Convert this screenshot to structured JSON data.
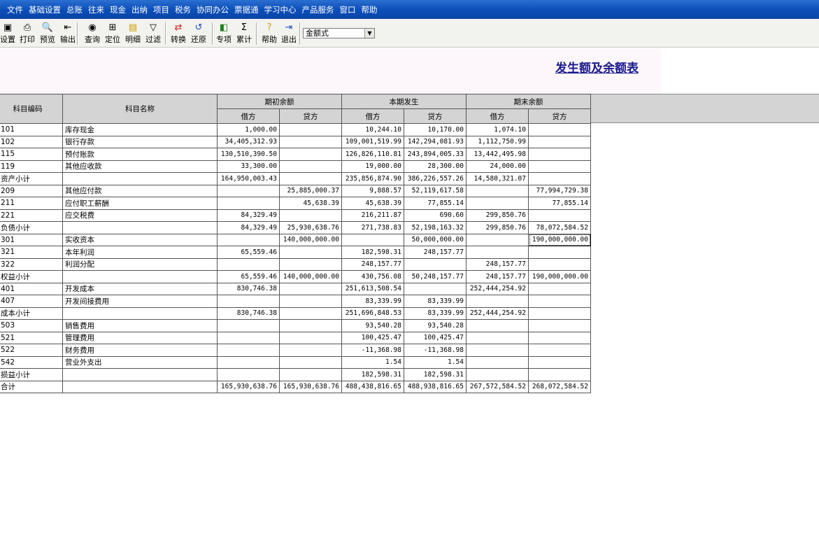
{
  "menu": [
    "文件",
    "基础设置",
    "总账",
    "往来",
    "现金",
    "出纳",
    "项目",
    "税务",
    "协同办公",
    "票据通",
    "学习中心",
    "产品服务",
    "窗口",
    "帮助"
  ],
  "toolbar": {
    "buttons": [
      {
        "label": "设置",
        "icon": "settings-icon"
      },
      {
        "label": "打印",
        "icon": "print-icon"
      },
      {
        "label": "预览",
        "icon": "preview-icon"
      },
      {
        "label": "输出",
        "icon": "export-icon"
      },
      {
        "label": "查询",
        "icon": "binoculars-icon"
      },
      {
        "label": "定位",
        "icon": "locate-icon"
      },
      {
        "label": "明细",
        "icon": "detail-icon"
      },
      {
        "label": "过滤",
        "icon": "filter-icon"
      },
      {
        "label": "转换",
        "icon": "convert-icon"
      },
      {
        "label": "还原",
        "icon": "restore-icon"
      },
      {
        "label": "专项",
        "icon": "special-icon"
      },
      {
        "label": "累计",
        "icon": "sigma-icon"
      },
      {
        "label": "帮助",
        "icon": "help-icon"
      },
      {
        "label": "退出",
        "icon": "exit-icon"
      }
    ],
    "format_select": "金额式"
  },
  "report_title": "发生额及余额表",
  "table": {
    "headers": {
      "code": "科目编码",
      "name": "科目名称",
      "opening": "期初余额",
      "period": "本期发生",
      "closing": "期末余额",
      "debit": "借方",
      "credit": "贷方"
    },
    "rows": [
      {
        "code": "101",
        "name": "库存现金",
        "od": "1,000.00",
        "oc": "",
        "pd": "10,244.10",
        "pc": "10,170.00",
        "cd": "1,074.10",
        "cc": ""
      },
      {
        "code": "102",
        "name": "银行存款",
        "od": "34,405,312.93",
        "oc": "",
        "pd": "109,001,519.99",
        "pc": "142,294,081.93",
        "cd": "1,112,750.99",
        "cc": ""
      },
      {
        "code": "115",
        "name": "预付账款",
        "od": "130,510,390.50",
        "oc": "",
        "pd": "126,826,110.81",
        "pc": "243,894,005.33",
        "cd": "13,442,495.98",
        "cc": ""
      },
      {
        "code": "119",
        "name": "其他应收款",
        "od": "33,300.00",
        "oc": "",
        "pd": "19,000.00",
        "pc": "28,300.00",
        "cd": "24,000.00",
        "cc": ""
      },
      {
        "code": "资产小计",
        "name": "",
        "od": "164,950,003.43",
        "oc": "",
        "pd": "235,856,874.90",
        "pc": "386,226,557.26",
        "cd": "14,580,321.07",
        "cc": ""
      },
      {
        "code": "209",
        "name": "其他应付款",
        "od": "",
        "oc": "25,885,000.37",
        "pd": "9,888.57",
        "pc": "52,119,617.58",
        "cd": "",
        "cc": "77,994,729.38"
      },
      {
        "code": "211",
        "name": "应付职工薪酬",
        "od": "",
        "oc": "45,638.39",
        "pd": "45,638.39",
        "pc": "77,855.14",
        "cd": "",
        "cc": "77,855.14"
      },
      {
        "code": "221",
        "name": "应交税费",
        "od": "84,329.49",
        "oc": "",
        "pd": "216,211.87",
        "pc": "690.60",
        "cd": "299,850.76",
        "cc": ""
      },
      {
        "code": "负债小计",
        "name": "",
        "od": "84,329.49",
        "oc": "25,930,638.76",
        "pd": "271,738.83",
        "pc": "52,198,163.32",
        "cd": "299,850.76",
        "cc": "78,072,584.52"
      },
      {
        "code": "301",
        "name": "实收资本",
        "od": "",
        "oc": "140,000,000.00",
        "pd": "",
        "pc": "50,000,000.00",
        "cd": "",
        "cc": "190,000,000.00"
      },
      {
        "code": "321",
        "name": "本年利润",
        "od": "65,559.46",
        "oc": "",
        "pd": "182,598.31",
        "pc": "248,157.77",
        "cd": "",
        "cc": ""
      },
      {
        "code": "322",
        "name": "利润分配",
        "od": "",
        "oc": "",
        "pd": "248,157.77",
        "pc": "",
        "cd": "248,157.77",
        "cc": ""
      },
      {
        "code": "权益小计",
        "name": "",
        "od": "65,559.46",
        "oc": "140,000,000.00",
        "pd": "430,756.08",
        "pc": "50,248,157.77",
        "cd": "248,157.77",
        "cc": "190,000,000.00"
      },
      {
        "code": "401",
        "name": "开发成本",
        "od": "830,746.38",
        "oc": "",
        "pd": "251,613,508.54",
        "pc": "",
        "cd": "252,444,254.92",
        "cc": ""
      },
      {
        "code": "407",
        "name": "开发间接费用",
        "od": "",
        "oc": "",
        "pd": "83,339.99",
        "pc": "83,339.99",
        "cd": "",
        "cc": ""
      },
      {
        "code": "成本小计",
        "name": "",
        "od": "830,746.38",
        "oc": "",
        "pd": "251,696,848.53",
        "pc": "83,339.99",
        "cd": "252,444,254.92",
        "cc": ""
      },
      {
        "code": "503",
        "name": "销售费用",
        "od": "",
        "oc": "",
        "pd": "93,540.28",
        "pc": "93,540.28",
        "cd": "",
        "cc": ""
      },
      {
        "code": "521",
        "name": "管理费用",
        "od": "",
        "oc": "",
        "pd": "100,425.47",
        "pc": "100,425.47",
        "cd": "",
        "cc": ""
      },
      {
        "code": "522",
        "name": "财务费用",
        "od": "",
        "oc": "",
        "pd": "-11,368.98",
        "pc": "-11,368.98",
        "cd": "",
        "cc": ""
      },
      {
        "code": "542",
        "name": "营业外支出",
        "od": "",
        "oc": "",
        "pd": "1.54",
        "pc": "1.54",
        "cd": "",
        "cc": ""
      },
      {
        "code": "损益小计",
        "name": "",
        "od": "",
        "oc": "",
        "pd": "182,598.31",
        "pc": "182,598.31",
        "cd": "",
        "cc": ""
      },
      {
        "code": "合计",
        "name": "",
        "od": "165,930,638.76",
        "oc": "165,930,638.76",
        "pd": "488,438,816.65",
        "pc": "488,938,816.65",
        "cd": "267,572,584.52",
        "cc": "268,072,584.52"
      }
    ],
    "selected_cell": {
      "row": 9,
      "col": "cc"
    }
  }
}
